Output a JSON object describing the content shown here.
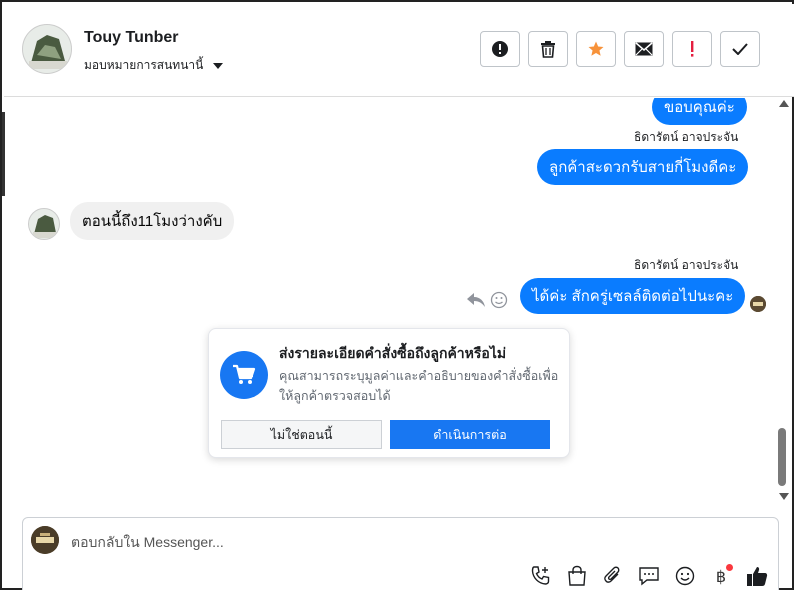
{
  "colors": {
    "accent": "#1877f2",
    "bubble_out": "#0a7cff",
    "bubble_in": "#f0f0f0",
    "star": "#f7923a",
    "alert": "#e41e3f"
  },
  "header": {
    "contact_name": "Touy Tunber",
    "assign_label": "มอบหมายการสนทนานี้",
    "actions": [
      {
        "name": "mark-spam-button",
        "icon": "alert-circle-icon"
      },
      {
        "name": "delete-button",
        "icon": "trash-icon"
      },
      {
        "name": "star-button",
        "icon": "star-icon"
      },
      {
        "name": "mark-unread-button",
        "icon": "envelope-icon"
      },
      {
        "name": "follow-up-button",
        "icon": "exclamation-icon"
      },
      {
        "name": "done-button",
        "icon": "check-icon"
      }
    ]
  },
  "thread": {
    "messages": [
      {
        "direction": "out",
        "text": "ขอบคุณค่ะ"
      },
      {
        "direction": "out",
        "sender": "ธิดารัตน์ อาจประจัน",
        "text": "ลูกค้าสะดวกรับสายกี่โมงดีคะ"
      },
      {
        "direction": "in",
        "text": "ตอนนี้ถึง11โมงว่างคับ"
      },
      {
        "direction": "out",
        "sender": "ธิดารัตน์ อาจประจัน",
        "text": "ได้ค่ะ สักครู่เซลล์ติดต่อไปนะคะ"
      }
    ]
  },
  "order_prompt": {
    "title": "ส่งรายละเอียดคำสั่งซื้อถึงลูกค้าหรือไม่",
    "description": "คุณสามารถระบุมูลค่าและคำอธิบายของคำสั่งซื้อเพื่อให้ลูกค้าตรวจสอบได้",
    "decline_label": "ไม่ใช่ตอนนี้",
    "continue_label": "ดำเนินการต่อ"
  },
  "composer": {
    "placeholder": "ตอบกลับใน Messenger...",
    "tools": [
      "phone-add-icon",
      "shopping-bag-icon",
      "paperclip-icon",
      "saved-reply-icon",
      "emoji-icon",
      "baht-payment-icon",
      "like-icon"
    ],
    "baht_symbol": "฿"
  }
}
